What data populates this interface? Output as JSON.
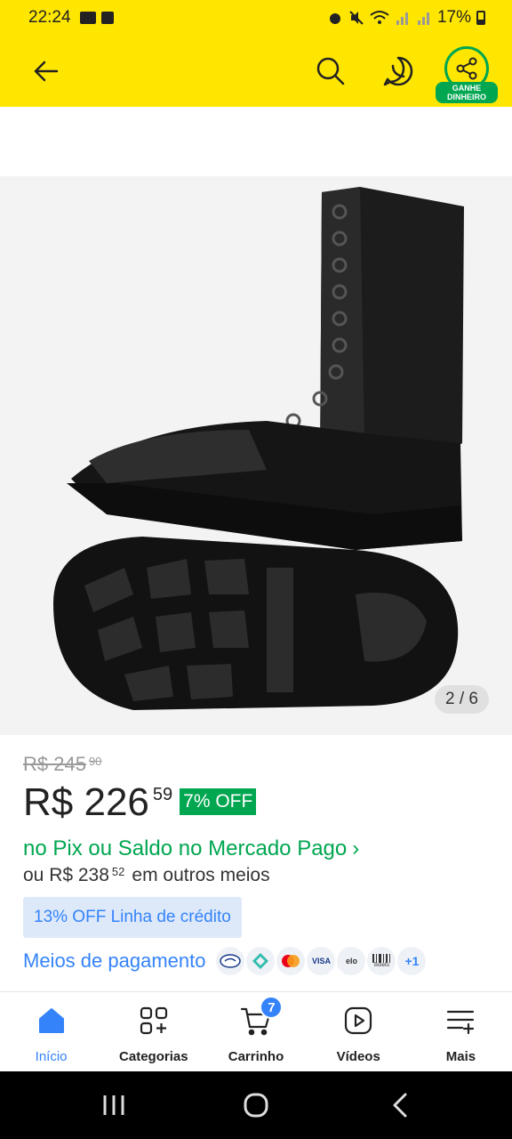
{
  "status_bar": {
    "time": "22:24",
    "battery": "17%"
  },
  "header": {
    "share_label": "GANHE DINHEIRO"
  },
  "gallery": {
    "counter": "2 / 6"
  },
  "product": {
    "old_price": "R$ 245",
    "old_price_cents": "90",
    "price": "R$ 226",
    "price_cents": "59",
    "discount": "7% OFF",
    "pix_text": "no Pix ou Saldo no Mercado Pago",
    "other_prefix": "ou R$ 238",
    "other_cents": "52",
    "other_suffix": "em outros meios",
    "credit_badge": "13% OFF Linha de crédito",
    "payment_link": "Meios de pagamento",
    "payment_more": "+1",
    "payment_icons": [
      "mercadopago-icon",
      "pix-icon",
      "mastercard-icon",
      "visa-icon",
      "elo-icon",
      "boleto-icon"
    ],
    "visa_text": "VISA",
    "elo_text": "elo",
    "boleto_text": "Boleto"
  },
  "bottom_nav": {
    "items": [
      {
        "label": "Início",
        "icon": "home-icon",
        "active": true
      },
      {
        "label": "Categorias",
        "icon": "categories-icon"
      },
      {
        "label": "Carrinho",
        "icon": "cart-icon",
        "badge": "7"
      },
      {
        "label": "Vídeos",
        "icon": "video-icon"
      },
      {
        "label": "Mais",
        "icon": "menu-plus-icon"
      }
    ]
  },
  "colors": {
    "brand_yellow": "#ffe600",
    "green": "#00a650",
    "blue": "#3483fa"
  }
}
